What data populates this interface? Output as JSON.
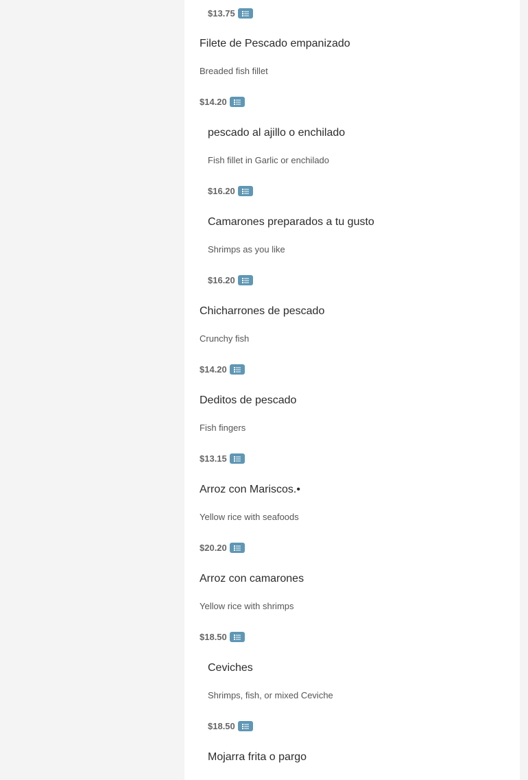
{
  "colors": {
    "page_background": "#f4f4f4",
    "panel_background": "#ffffff",
    "button_accent": "#5f97b5",
    "price_text": "#666666"
  },
  "icons": {
    "list_button": "list-icon"
  },
  "top_price": "$13.75",
  "items": [
    {
      "name": "Filete de Pescado empanizado",
      "description": "Breaded fish fillet",
      "price": "$14.20"
    },
    {
      "name": "pescado al ajillo o enchilado",
      "description": "Fish fillet in Garlic or enchilado",
      "price": "$16.20"
    },
    {
      "name": "Camarones preparados a tu gusto",
      "description": "Shrimps as you like",
      "price": "$16.20"
    },
    {
      "name": "Chicharrones de pescado",
      "description": "Crunchy fish",
      "price": "$14.20"
    },
    {
      "name": "Deditos de pescado",
      "description": "Fish fingers",
      "price": "$13.15"
    },
    {
      "name": "Arroz con Mariscos.•",
      "description": "Yellow rice with seafoods",
      "price": "$20.20"
    },
    {
      "name": "Arroz con camarones",
      "description": "Yellow rice with shrimps",
      "price": "$18.50"
    },
    {
      "name": "Ceviches",
      "description": "Shrimps, fish, or mixed Ceviche",
      "price": "$18.50"
    },
    {
      "name": "Mojarra frita o pargo",
      "description": "",
      "price": ""
    }
  ]
}
